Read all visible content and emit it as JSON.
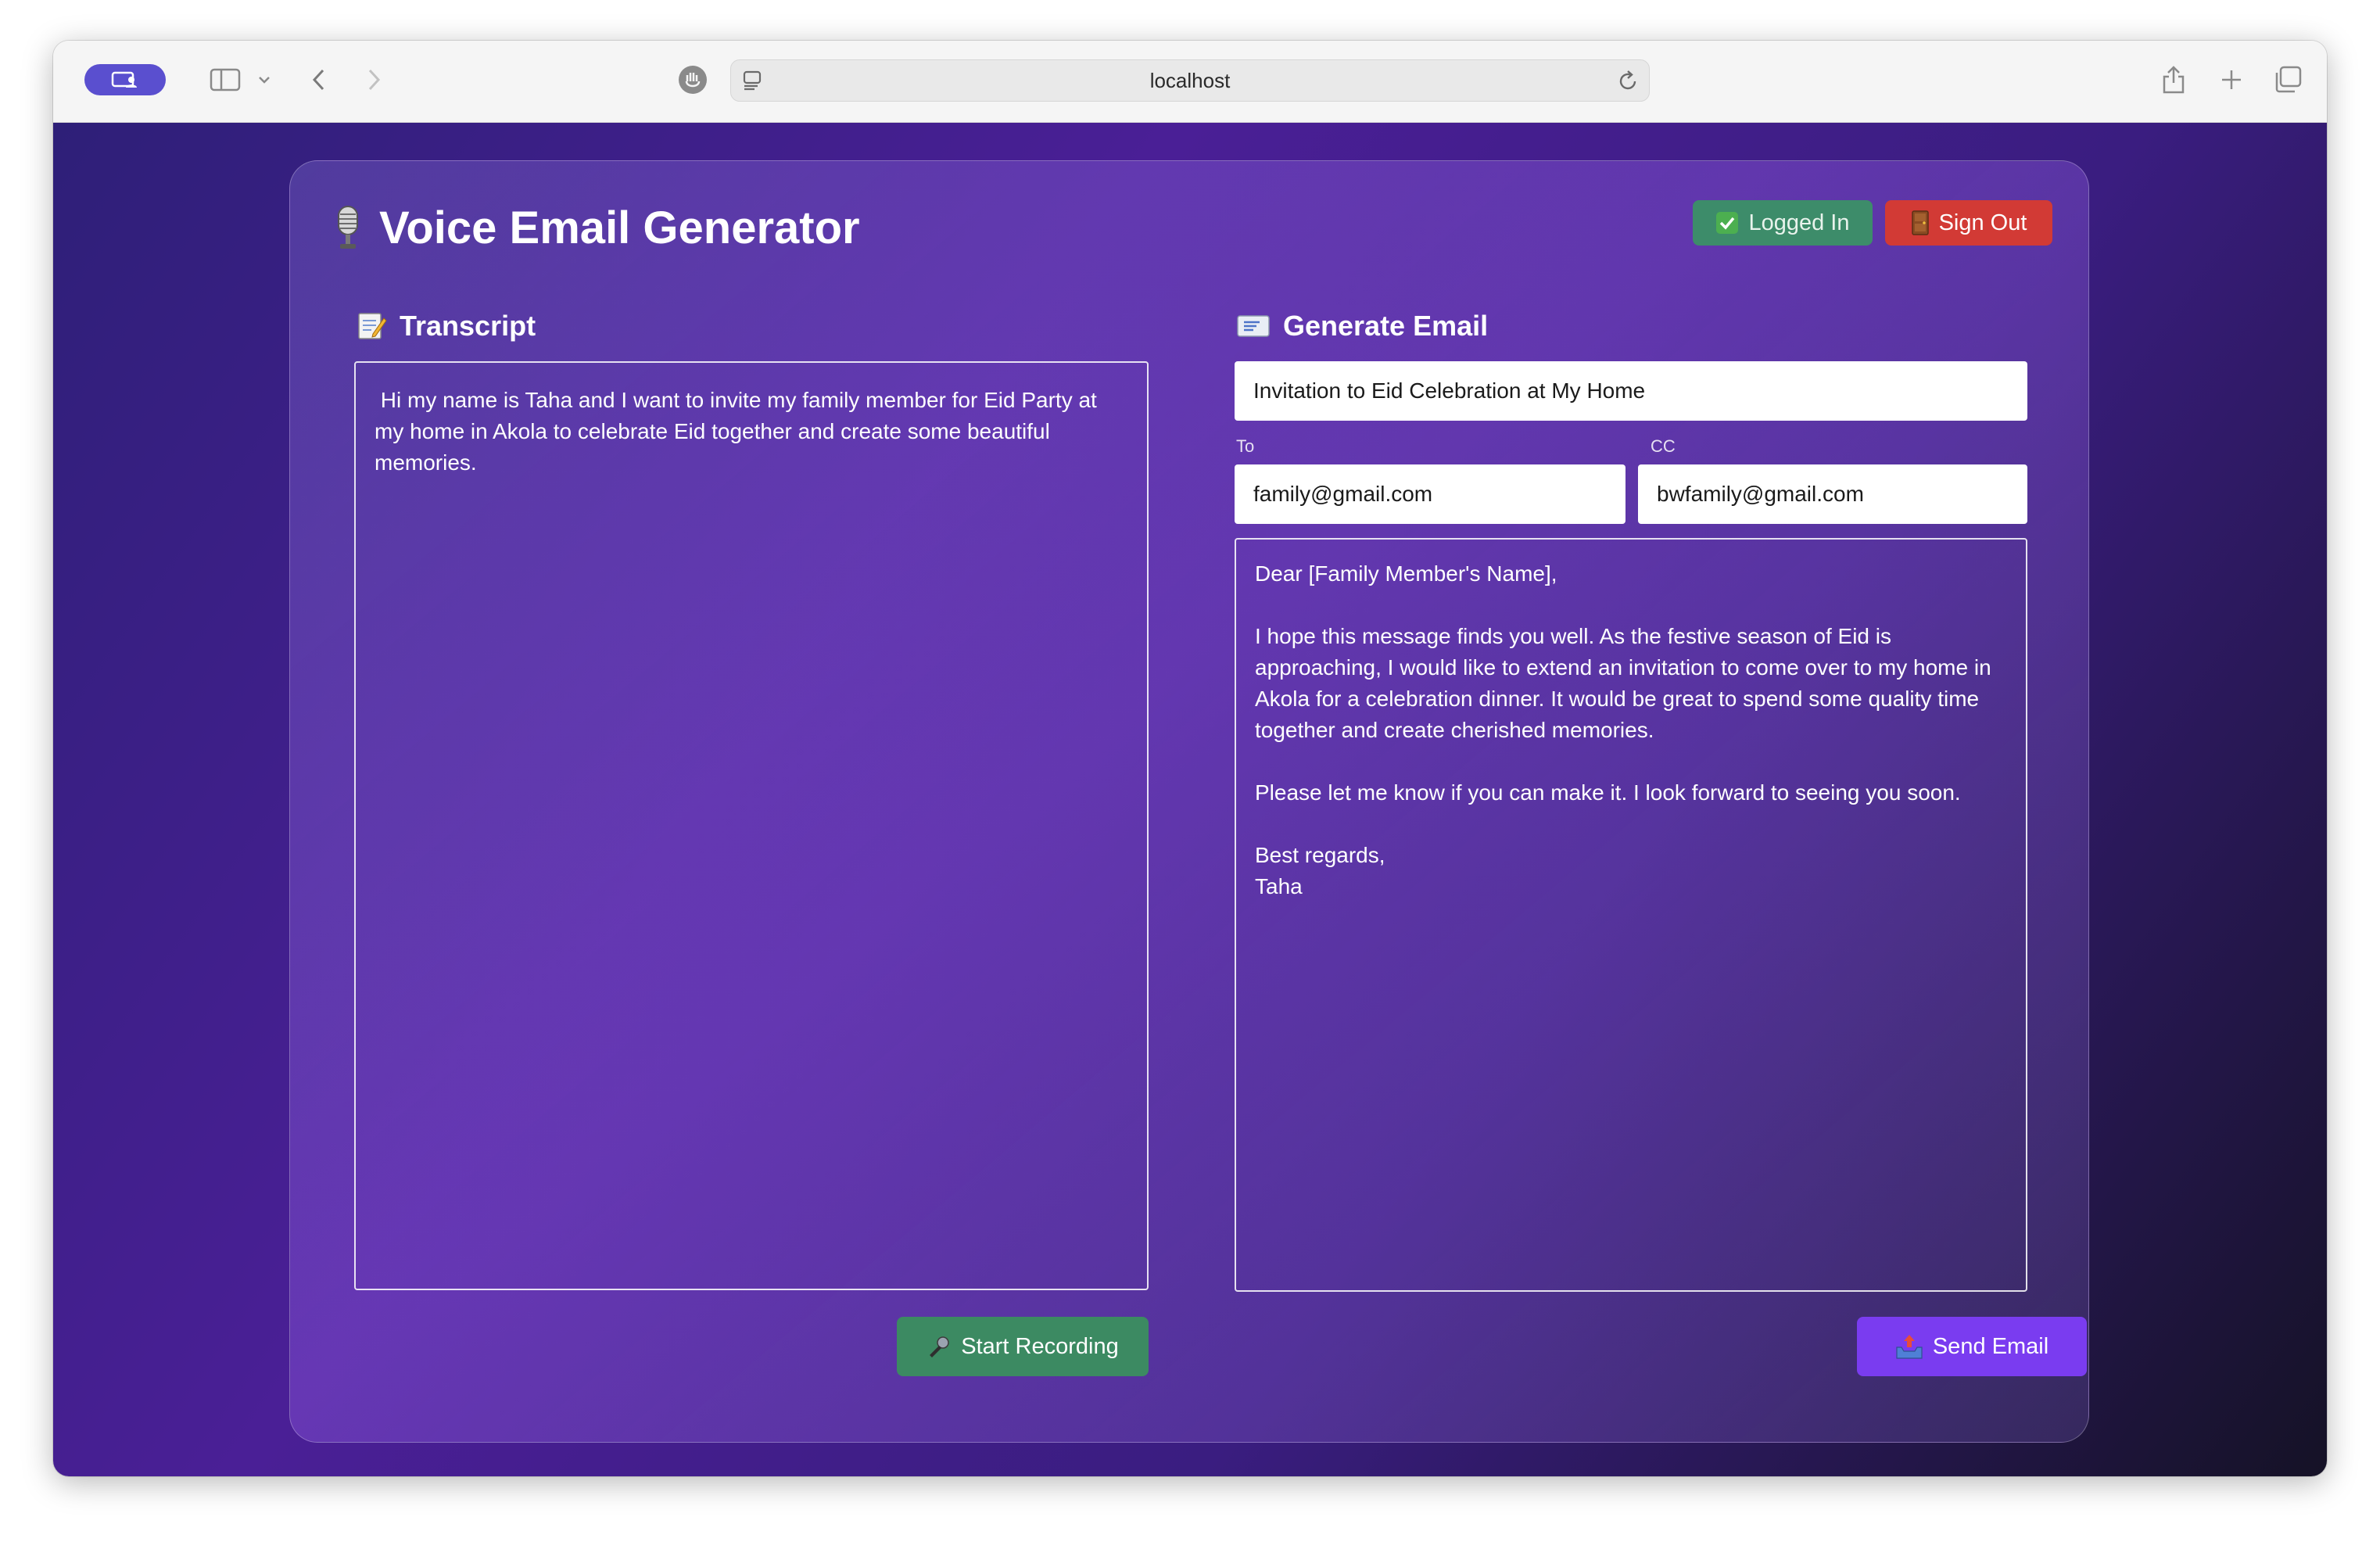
{
  "browser": {
    "url": "localhost"
  },
  "app": {
    "title": "Voice Email Generator",
    "logged_in_label": "Logged In",
    "sign_out_label": "Sign Out"
  },
  "transcript": {
    "heading": "Transcript",
    "text": " Hi my name is Taha and I want to invite my family member for Eid Party at my home in Akola to celebrate Eid together and create some beautiful memories.",
    "record_label": "Start Recording"
  },
  "email": {
    "heading": "Generate Email",
    "subject": "Invitation to Eid Celebration at My Home",
    "to_label": "To",
    "to_value": "family@gmail.com",
    "cc_label": "CC",
    "cc_value": "bwfamily@gmail.com",
    "body": [
      "Dear [Family Member's Name],",
      "I hope this message finds you well. As the festive season of Eid is approaching, I would like to extend an invitation to come over to my home in Akola for a celebration dinner. It would be great to spend some quality time together and create cherished memories.",
      "Please let me know if you can make it. I look forward to seeing you soon.",
      "Best regards,",
      "Taha"
    ],
    "send_label": "Send Email"
  },
  "colors": {
    "logged_in": "#3d8c6a",
    "sign_out": "#d23a35",
    "record": "#3c8a62",
    "send": "#7a3cf0",
    "profile_pill": "#5a4fcf"
  },
  "icons": {
    "title": "studio-microphone-icon",
    "logged_in": "check-mark-icon",
    "sign_out": "door-icon",
    "transcript": "memo-icon",
    "email": "envelope-icon",
    "record": "microphone-icon",
    "send": "outbox-tray-icon"
  }
}
